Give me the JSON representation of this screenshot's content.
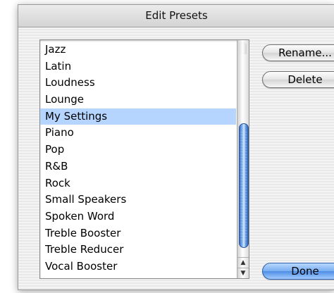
{
  "window": {
    "title": "Edit Presets"
  },
  "presets": {
    "items": [
      "Jazz",
      "Latin",
      "Loudness",
      "Lounge",
      "My Settings",
      "Piano",
      "Pop",
      "R&B",
      "Rock",
      "Small Speakers",
      "Spoken Word",
      "Treble Booster",
      "Treble Reducer",
      "Vocal Booster"
    ],
    "selected": "My Settings"
  },
  "buttons": {
    "rename": "Rename...",
    "delete": "Delete",
    "done": "Done"
  },
  "scrollbar": {
    "up_arrow_icon": "▲",
    "down_arrow_icon": "▼"
  }
}
